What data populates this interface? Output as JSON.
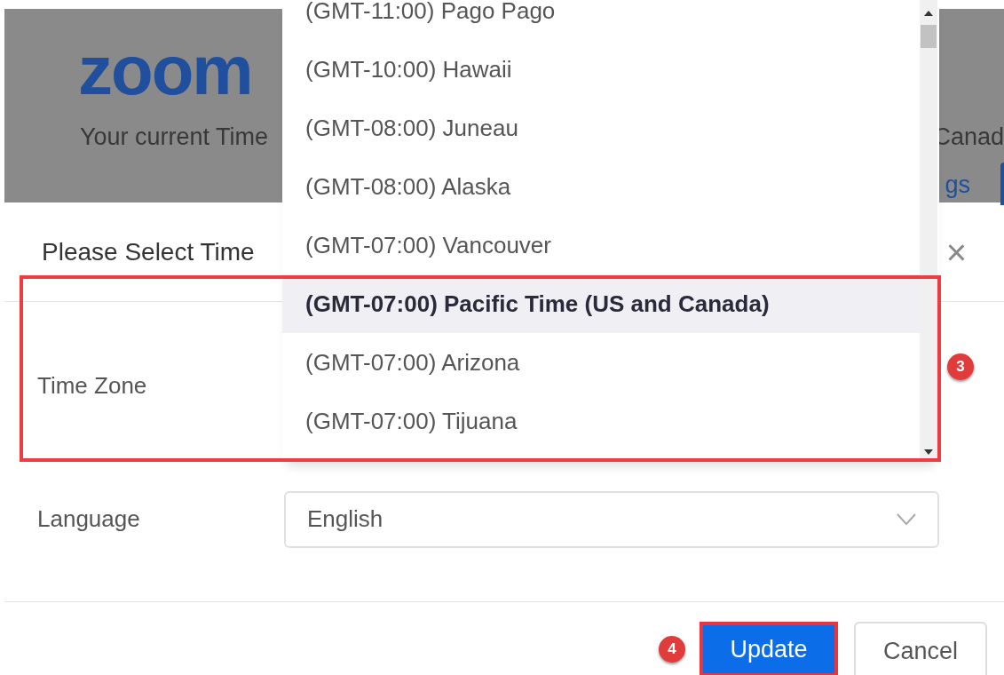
{
  "background": {
    "logo": "zoom",
    "text_left": "Your current Time",
    "text_right": "Canad",
    "link": "gs"
  },
  "dialog": {
    "title": "Please Select Time",
    "close": "×",
    "fields": [
      {
        "label": "Time Zone"
      },
      {
        "label": "Language",
        "value": "English"
      }
    ],
    "buttons": [
      {
        "label": "Update",
        "kind": "primary"
      },
      {
        "label": "Cancel",
        "kind": "secondary"
      }
    ]
  },
  "dropdown": {
    "options": [
      {
        "label": "(GMT-11:00) Pago Pago",
        "selected": false
      },
      {
        "label": "(GMT-10:00) Hawaii",
        "selected": false
      },
      {
        "label": "(GMT-08:00) Juneau",
        "selected": false
      },
      {
        "label": "(GMT-08:00) Alaska",
        "selected": false
      },
      {
        "label": "(GMT-07:00) Vancouver",
        "selected": false
      },
      {
        "label": "(GMT-07:00) Pacific Time (US and Canada)",
        "selected": true
      },
      {
        "label": "(GMT-07:00) Arizona",
        "selected": false
      },
      {
        "label": "(GMT-07:00) Tijuana",
        "selected": false
      }
    ]
  },
  "annotations": [
    {
      "number": "3"
    },
    {
      "number": "4"
    }
  ]
}
